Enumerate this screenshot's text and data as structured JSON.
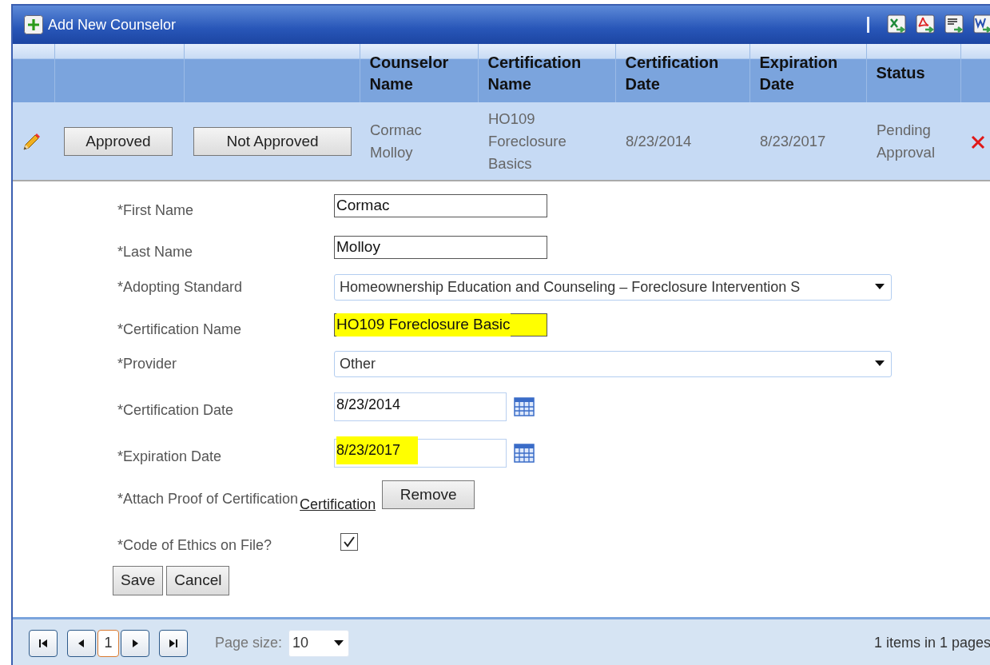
{
  "toolbar": {
    "add_button": "Add New Counselor",
    "exports": [
      {
        "kind": "excel"
      },
      {
        "kind": "pdf"
      },
      {
        "kind": "csv"
      },
      {
        "kind": "word"
      }
    ]
  },
  "table": {
    "columns": [
      "Counselor Name",
      "Certification Name",
      "Certification Date",
      "Expiration Date",
      "Status"
    ],
    "rows": [
      {
        "approve_button": "Approved",
        "reject_button": "Not Approved",
        "cells": [
          "Cormac Molloy",
          "HO109 Foreclosure Basics",
          "8/23/2014",
          "8/23/2017",
          "Pending Approval"
        ]
      }
    ]
  },
  "form": {
    "fields": [
      {
        "kind": "text",
        "label": "*First Name",
        "value": "Cormac",
        "highlighted": false
      },
      {
        "kind": "text",
        "label": "*Last Name",
        "value": "Molloy",
        "highlighted": false
      },
      {
        "kind": "select",
        "label": "*Adopting Standard",
        "value": "Homeownership Education and Counseling – Foreclosure Intervention S",
        "highlighted": false
      },
      {
        "kind": "text",
        "label": "*Certification Name",
        "value": "HO109 Foreclosure Basic",
        "highlighted": true
      },
      {
        "kind": "select",
        "label": "*Provider",
        "value": "Other",
        "highlighted": false
      },
      {
        "kind": "date",
        "label": "*Certification Date",
        "value": "8/23/2014",
        "highlighted": false
      },
      {
        "kind": "date",
        "label": "*Expiration Date",
        "value": "8/23/2017",
        "highlighted": true
      },
      {
        "kind": "attachment",
        "label": "*Attach Proof of Certification",
        "link": "Certification",
        "button": "Remove"
      },
      {
        "kind": "checkbox",
        "label": "*Code of Ethics on File?",
        "checked": true
      }
    ],
    "buttons": [
      "Save",
      "Cancel"
    ]
  },
  "pager": {
    "pages": [
      {
        "label": "1",
        "selected": true
      }
    ],
    "page_size_label": "Page size:",
    "page_size": "10",
    "summary": "1 items in 1 pages"
  }
}
